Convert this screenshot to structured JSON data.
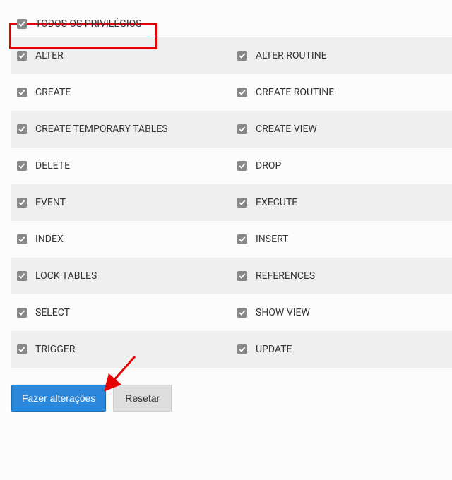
{
  "header": {
    "master_label": "TODOS OS PRIVILÉGIOS"
  },
  "privileges": [
    {
      "left": "ALTER",
      "right": "ALTER ROUTINE"
    },
    {
      "left": "CREATE",
      "right": "CREATE ROUTINE"
    },
    {
      "left": "CREATE TEMPORARY TABLES",
      "right": "CREATE VIEW"
    },
    {
      "left": "DELETE",
      "right": "DROP"
    },
    {
      "left": "EVENT",
      "right": "EXECUTE"
    },
    {
      "left": "INDEX",
      "right": "INSERT"
    },
    {
      "left": "LOCK TABLES",
      "right": "REFERENCES"
    },
    {
      "left": "SELECT",
      "right": "SHOW VIEW"
    },
    {
      "left": "TRIGGER",
      "right": "UPDATE"
    }
  ],
  "buttons": {
    "submit": "Fazer alterações",
    "reset": "Resetar"
  },
  "colors": {
    "highlight": "#e60000",
    "arrow": "#e60000",
    "primary": "#2b87da"
  }
}
